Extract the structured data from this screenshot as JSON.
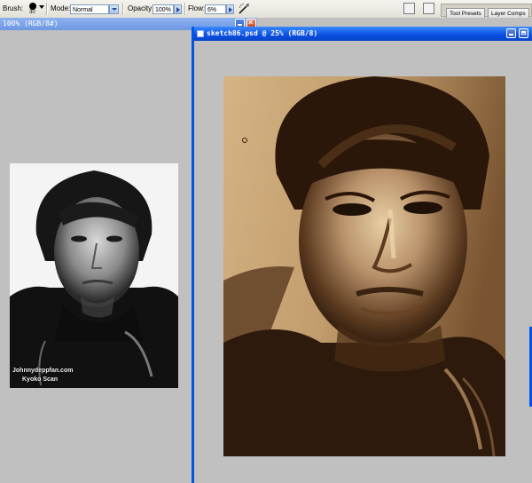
{
  "options_bar": {
    "brush_label": "Brush:",
    "brush_size": "30",
    "mode_label": "Mode:",
    "mode_value": "Normal",
    "opacity_label": "Opacity:",
    "opacity_value": "100%",
    "flow_label": "Flow:",
    "flow_value": "6%"
  },
  "palette_tabs": [
    "Tool Presets",
    "Layer Comps"
  ],
  "back_window": {
    "title": "100% (RGB/8#)",
    "photo_watermark_line1": "Johnnydeppfan.com",
    "photo_watermark_line2": "Kyoko Scan"
  },
  "active_window": {
    "title": "sketch86.psd @ 25% (RGB/8)"
  },
  "colors": {
    "workspace": "#c0c0c0",
    "active_title": "#0a4ee0",
    "inactive_title": "#7ea5eb",
    "sepia_dark": "#3b2412",
    "sepia_light": "#d8b88c"
  }
}
